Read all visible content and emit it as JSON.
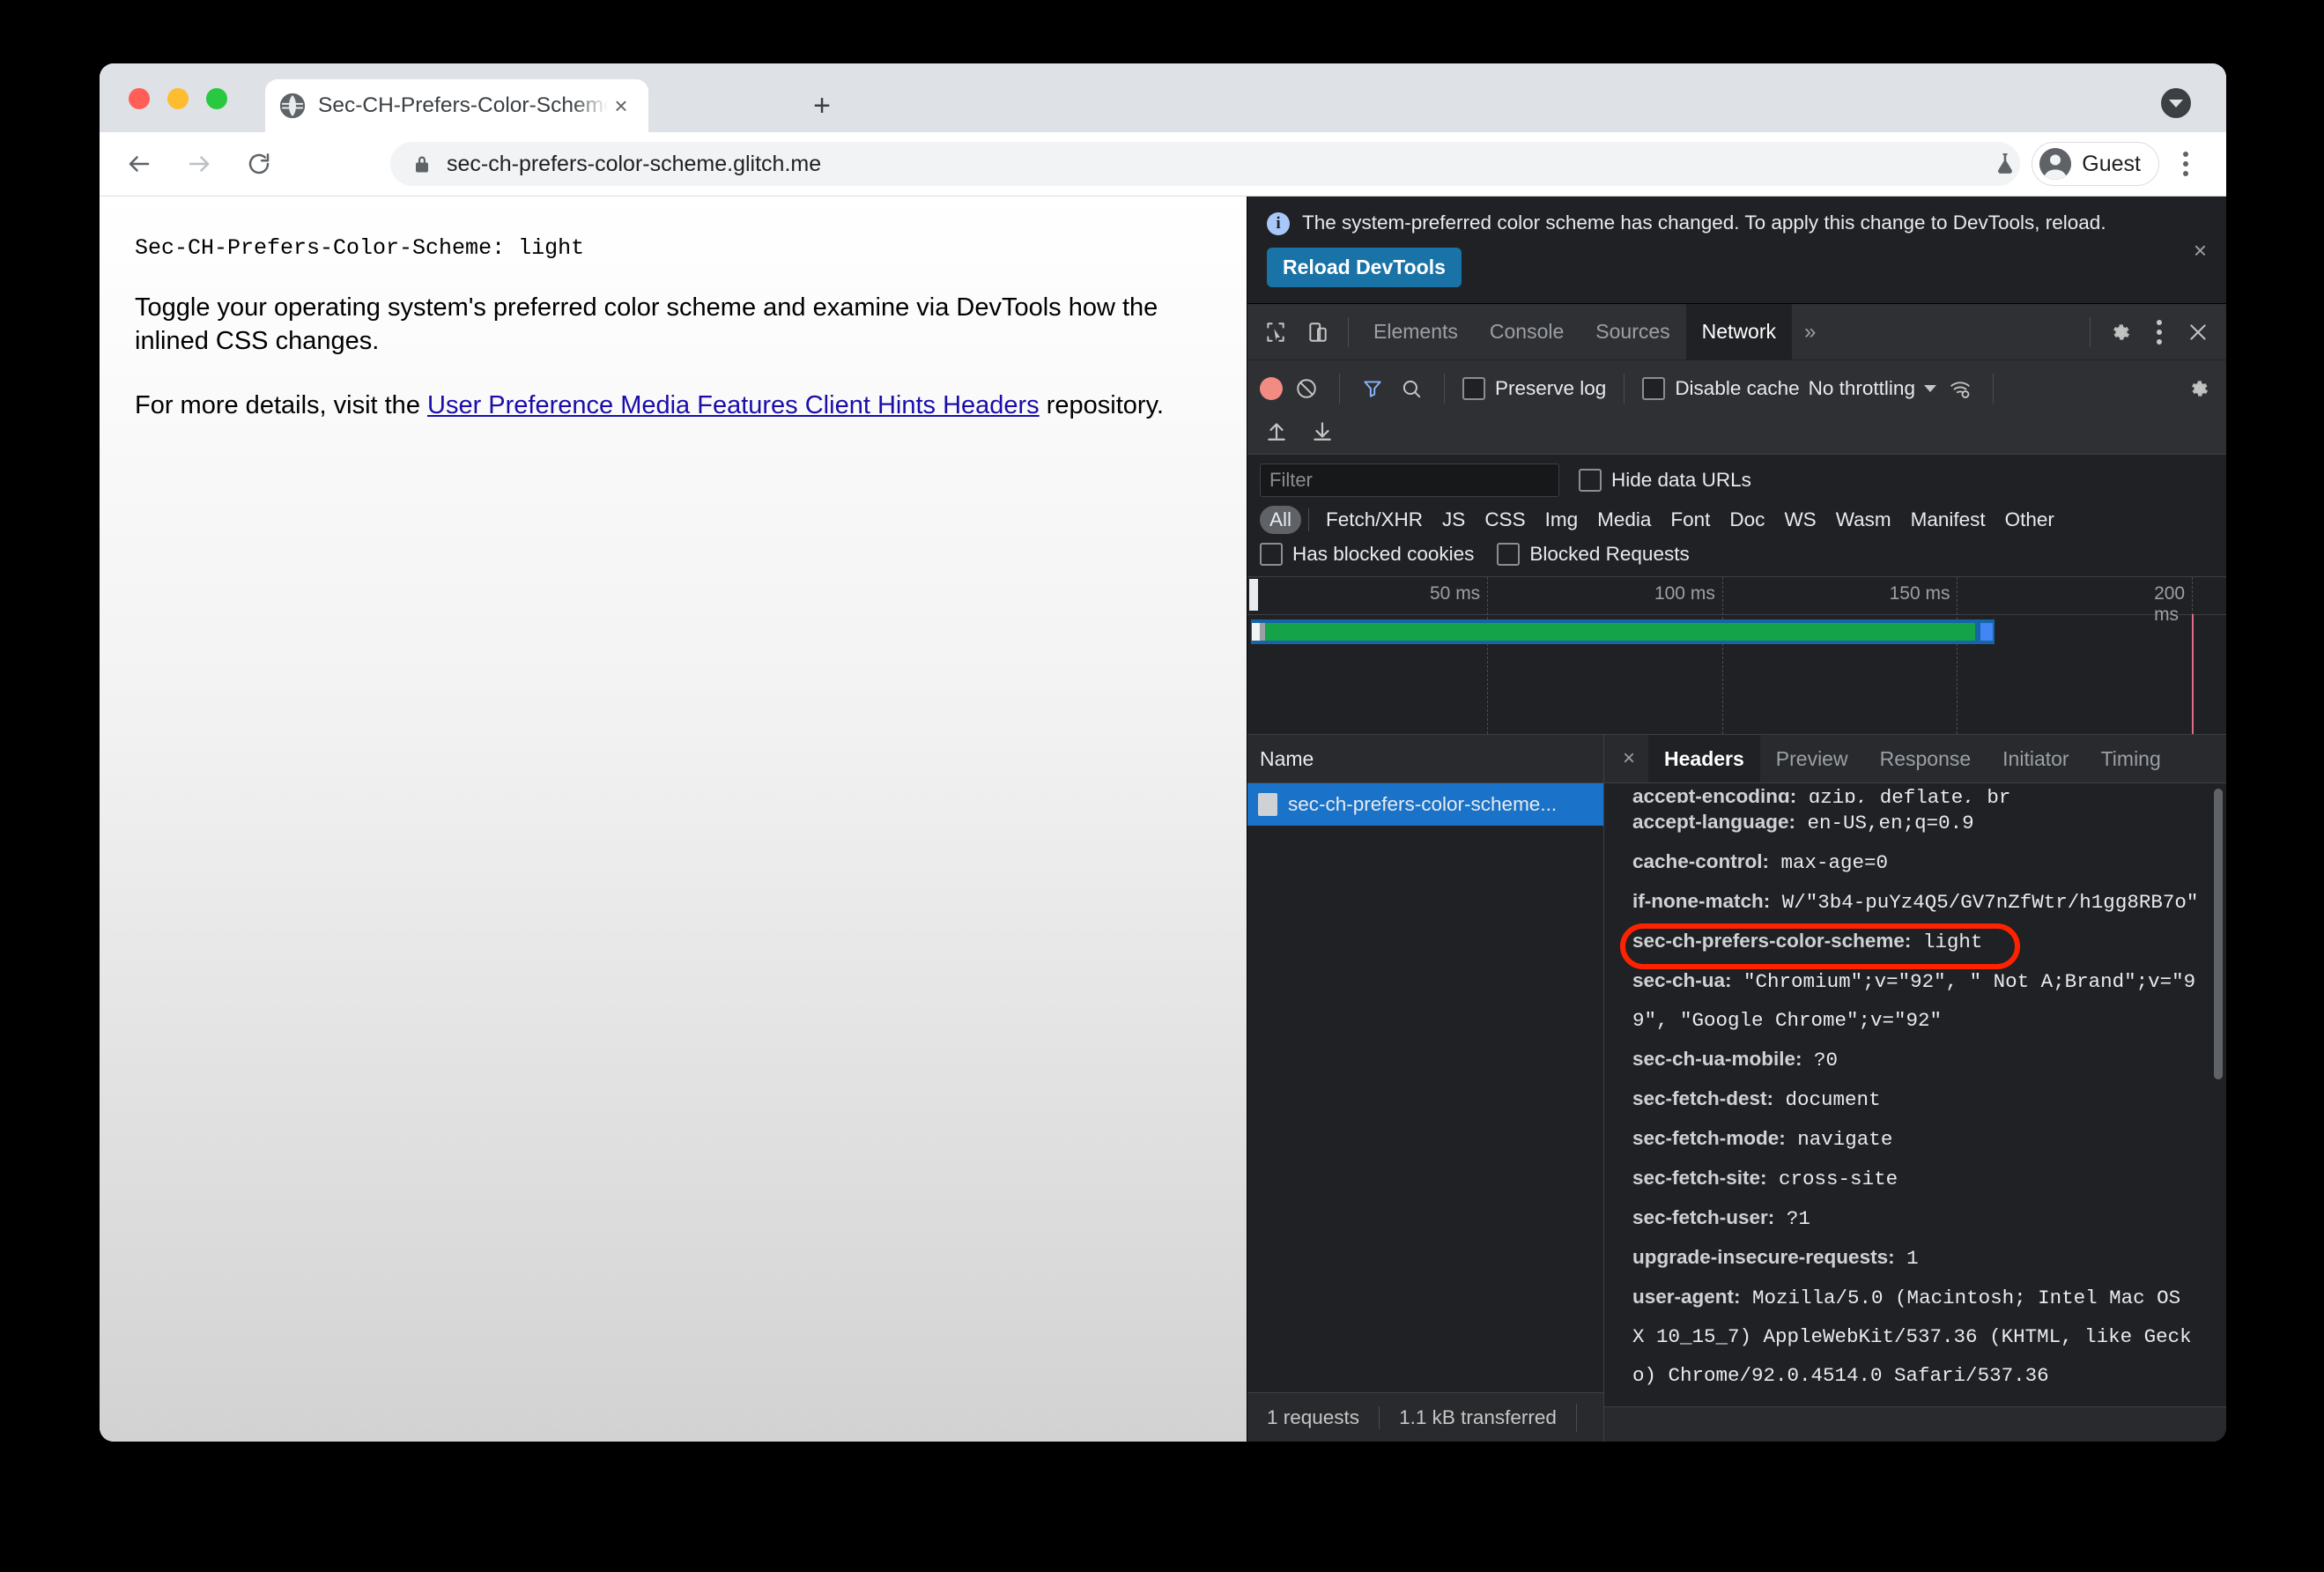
{
  "browser": {
    "tab": {
      "title": "Sec-CH-Prefers-Color-Scheme",
      "favicon": "globe-icon",
      "close": "×"
    },
    "new_tab": "+",
    "tab_list_menu": "chevron-down-icon",
    "nav": {
      "back": "back-arrow-icon",
      "forward": "forward-arrow-icon",
      "reload": "reload-icon"
    },
    "omnibox": {
      "lock": "lock-icon",
      "url": "sec-ch-prefers-color-scheme.glitch.me"
    },
    "flask": "flask-icon",
    "profile": {
      "label": "Guest",
      "avatar": "person-icon"
    },
    "menu": "kebab-menu-icon"
  },
  "page": {
    "header": "Sec-CH-Prefers-Color-Scheme: light",
    "paragraph1": "Toggle your operating system's preferred color scheme and examine via DevTools how the inlined CSS changes.",
    "paragraph2_before": "For more details, visit the ",
    "paragraph2_link": "User Preference Media Features Client Hints Headers",
    "paragraph2_after": " repository."
  },
  "devtools": {
    "notice": {
      "icon": "info-icon",
      "text": "The system-preferred color scheme has changed. To apply this change to DevTools, reload.",
      "button": "Reload DevTools",
      "close": "×"
    },
    "panel_tabs": {
      "inspect_icon": "inspect-cursor-icon",
      "device_icon": "device-toggle-icon",
      "items": [
        "Elements",
        "Console",
        "Sources",
        "Network"
      ],
      "active": "Network",
      "more": "»",
      "settings_icon": "gear-icon",
      "kebab_icon": "kebab-menu-icon",
      "close_icon": "close-icon"
    },
    "network_toolbar": {
      "record_icon": "record-icon",
      "clear_icon": "clear-icon",
      "filter_icon": "filter-funnel-icon",
      "search_icon": "search-icon",
      "preserve_log": "Preserve log",
      "disable_cache": "Disable cache",
      "throttling": "No throttling",
      "wifi_icon": "network-conditions-icon",
      "settings_icon": "gear-icon",
      "import_icon": "import-har-icon",
      "export_icon": "export-har-icon"
    },
    "filters": {
      "filter_placeholder": "Filter",
      "filter_value": "",
      "hide_data_urls": "Hide data URLs",
      "types": [
        "All",
        "Fetch/XHR",
        "JS",
        "CSS",
        "Img",
        "Media",
        "Font",
        "Doc",
        "WS",
        "Wasm",
        "Manifest",
        "Other"
      ],
      "active_type": "All",
      "has_blocked_cookies": "Has blocked cookies",
      "blocked_requests": "Blocked Requests"
    },
    "overview": {
      "ticks": [
        "50 ms",
        "100 ms",
        "150 ms",
        "200 ms"
      ]
    },
    "requests": {
      "column_header": "Name",
      "rows": [
        {
          "name": "sec-ch-prefers-color-scheme...",
          "icon": "document-icon",
          "selected": true
        }
      ]
    },
    "status": {
      "requests": "1 requests",
      "transferred": "1.1 kB transferred"
    },
    "detail": {
      "close": "×",
      "tabs": [
        "Headers",
        "Preview",
        "Response",
        "Initiator",
        "Timing"
      ],
      "active_tab": "Headers",
      "headers": [
        {
          "name": "accept-encoding:",
          "value": " gzip, deflate, br",
          "clipped": true,
          "highlight": false
        },
        {
          "name": "accept-language:",
          "value": " en-US,en;q=0.9",
          "highlight": false
        },
        {
          "name": "cache-control:",
          "value": " max-age=0",
          "highlight": false
        },
        {
          "name": "if-none-match:",
          "value": " W/\"3b4-puYz4Q5/GV7nZfWtr/h1gg8RB7o\"",
          "highlight": false
        },
        {
          "name": "sec-ch-prefers-color-scheme:",
          "value": " light",
          "highlight": true
        },
        {
          "name": "sec-ch-ua:",
          "value": " \"Chromium\";v=\"92\", \" Not A;Brand\";v=\"99\", \"Google Chrome\";v=\"92\"",
          "highlight": false
        },
        {
          "name": "sec-ch-ua-mobile:",
          "value": " ?0",
          "highlight": false
        },
        {
          "name": "sec-fetch-dest:",
          "value": " document",
          "highlight": false
        },
        {
          "name": "sec-fetch-mode:",
          "value": " navigate",
          "highlight": false
        },
        {
          "name": "sec-fetch-site:",
          "value": " cross-site",
          "highlight": false
        },
        {
          "name": "sec-fetch-user:",
          "value": " ?1",
          "highlight": false
        },
        {
          "name": "upgrade-insecure-requests:",
          "value": " 1",
          "highlight": false
        },
        {
          "name": "user-agent:",
          "value": " Mozilla/5.0 (Macintosh; Intel Mac OS X 10_15_7) AppleWebKit/537.36 (KHTML, like Gecko) Chrome/92.0.4514.0 Safari/537.36",
          "highlight": false
        }
      ]
    }
  },
  "colors": {
    "accent_blue": "#1a73c8",
    "highlight_red": "#ff2200",
    "record_red": "#f28b82",
    "link_blue": "#1a0dab",
    "timeline_green": "#15a34a",
    "timeline_blue": "#1565a8"
  }
}
